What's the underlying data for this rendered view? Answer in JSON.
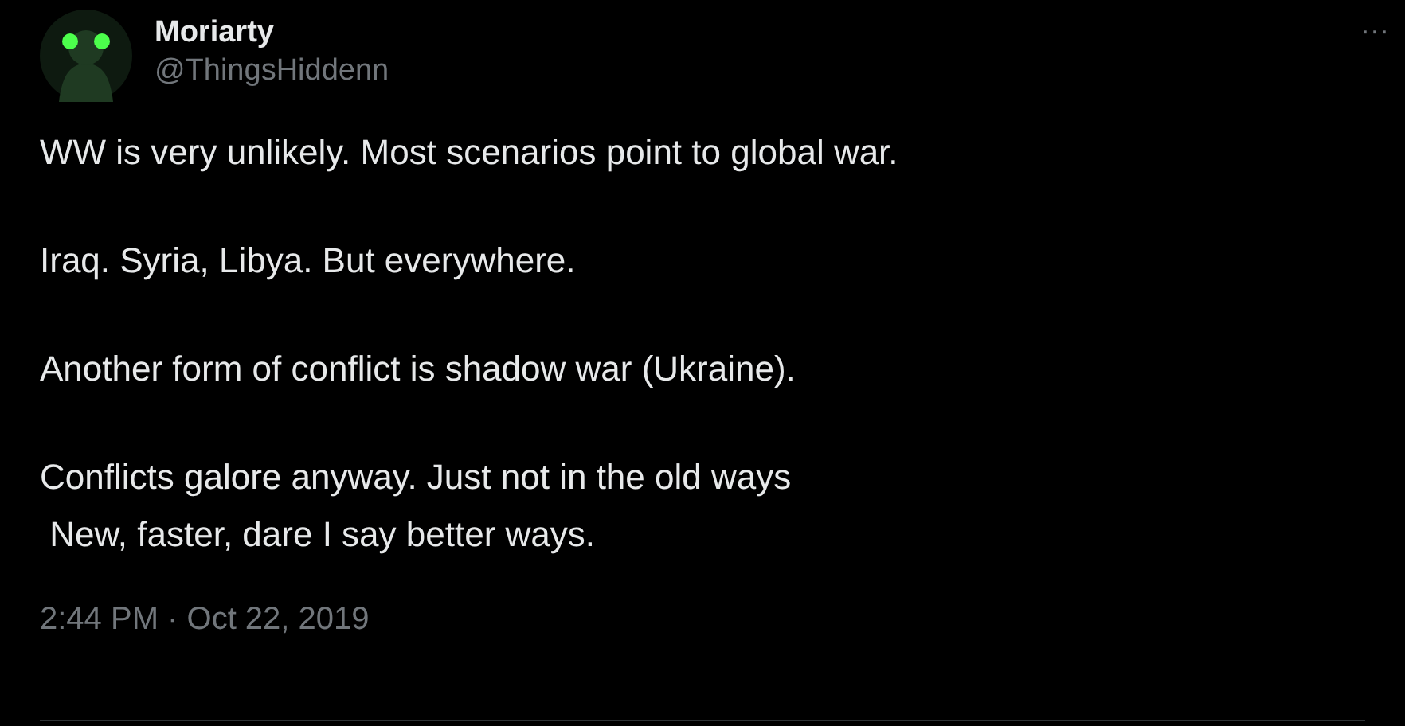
{
  "author": {
    "name": "Moriarty",
    "handle": "@ThingsHiddenn"
  },
  "more_button": "···",
  "paragraphs": [
    "WW is very unlikely. Most scenarios point to global war.",
    "Iraq. Syria, Libya. But everywhere.",
    "Another form of conflict is shadow war (Ukraine).",
    "Conflicts galore anyway. Just not in the old ways\n New, faster, dare I say better ways."
  ],
  "timestamp": "2:44 PM · Oct 22, 2019"
}
